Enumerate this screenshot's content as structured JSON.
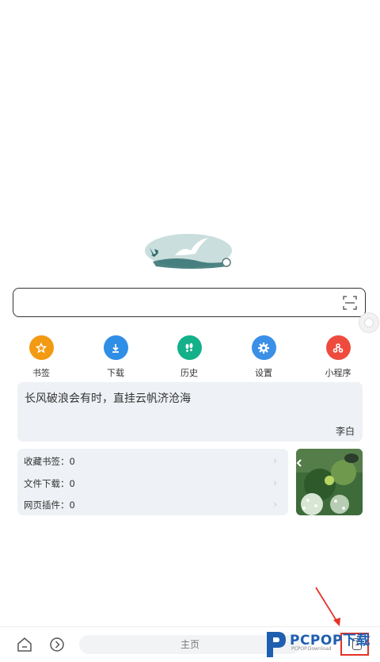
{
  "search": {
    "placeholder": "",
    "value": ""
  },
  "quick_links": [
    {
      "label": "书签",
      "icon": "star-icon",
      "color": "#f39a13"
    },
    {
      "label": "下载",
      "icon": "download-icon",
      "color": "#2f8ee5"
    },
    {
      "label": "历史",
      "icon": "footprints-icon",
      "color": "#14b08a"
    },
    {
      "label": "设置",
      "icon": "gear-icon",
      "color": "#3a8fe6"
    },
    {
      "label": "小程序",
      "icon": "mini-program-icon",
      "color": "#ee4b3e"
    }
  ],
  "quote": {
    "text": "长风破浪会有时，直挂云帆济沧海",
    "author": "李白"
  },
  "stats": [
    {
      "label": "收藏书签：0"
    },
    {
      "label": "文件下载：0"
    },
    {
      "label": "网页插件：0"
    }
  ],
  "bottom_bar": {
    "home_tab_label": "主页",
    "tab_count": "1"
  },
  "watermark": {
    "brand": "PCPOP下载",
    "sub": "PCPOP.Download"
  },
  "colors": {
    "highlight": "#e53226",
    "card_bg": "#eef1f5"
  }
}
